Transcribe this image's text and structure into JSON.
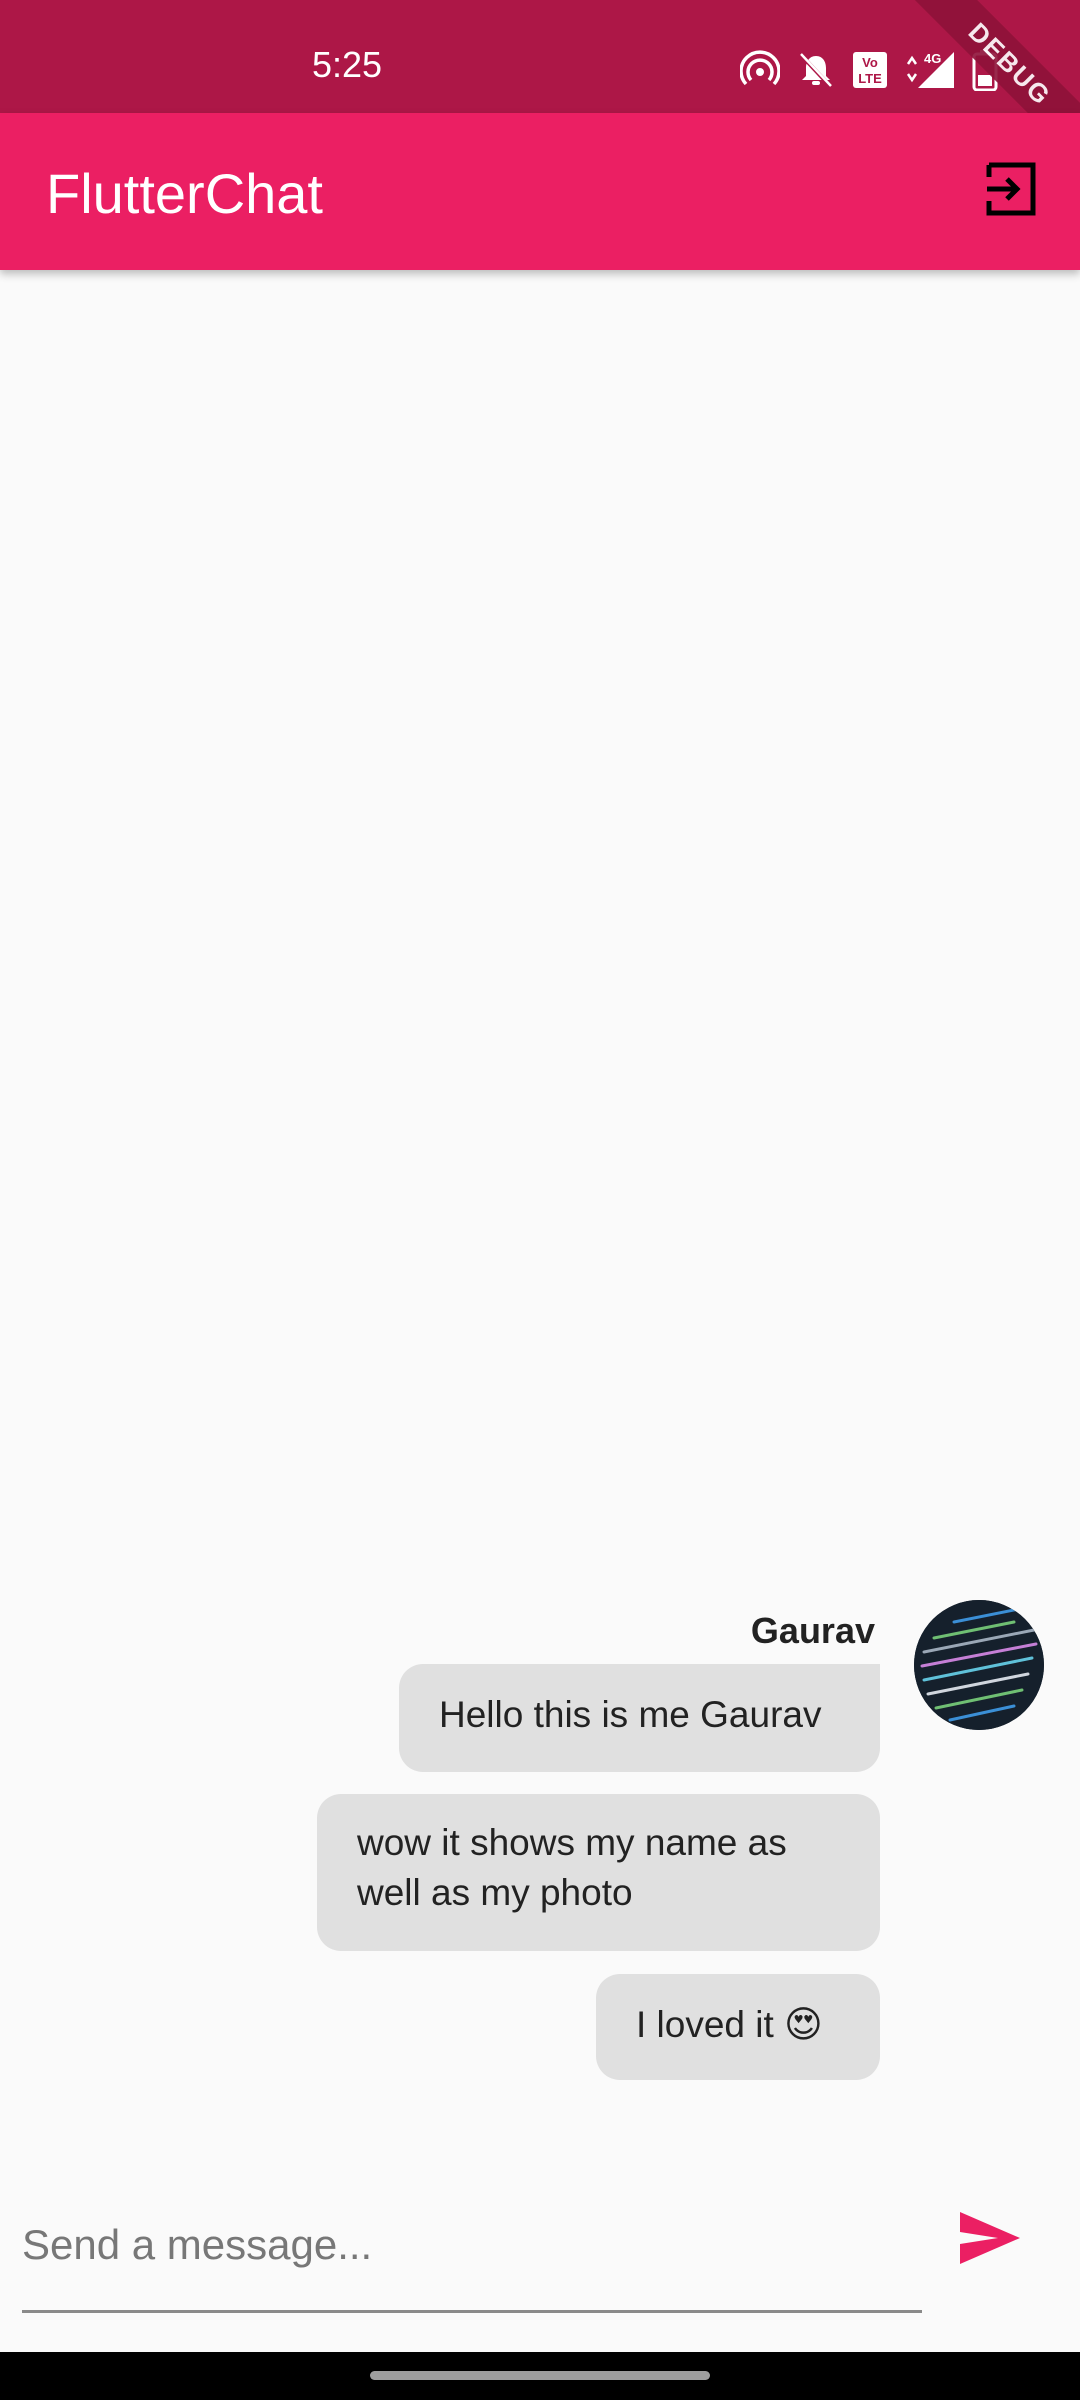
{
  "status_bar": {
    "time": "5:25",
    "icons": [
      "hotspot-icon",
      "bell-off-icon",
      "volte-icon",
      "signal-4g-icon",
      "battery-icon"
    ],
    "network_label": "4G",
    "volte_label": "Vo LTE"
  },
  "debug_banner": "DEBUG",
  "app_bar": {
    "title": "FlutterChat",
    "logout_icon": "logout-icon",
    "background": "#eb1f63"
  },
  "chat": {
    "sender_name": "Gaurav",
    "messages": [
      {
        "text": "Hello this is me Gaurav"
      },
      {
        "text": "wow it shows my name as well as my photo"
      },
      {
        "text": "I loved it 😍"
      }
    ]
  },
  "composer": {
    "placeholder": "Send a message...",
    "value": "",
    "send_icon": "send-icon",
    "accent": "#eb1f63"
  }
}
